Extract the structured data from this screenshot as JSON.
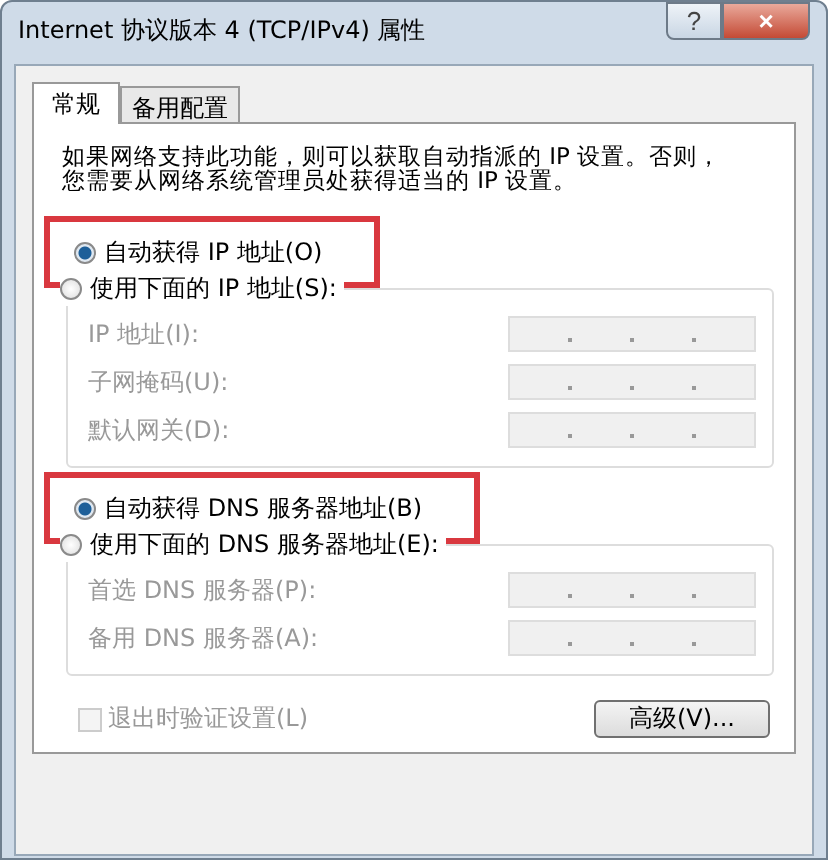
{
  "window": {
    "title": "Internet 协议版本 4 (TCP/IPv4) 属性",
    "help_button": "?",
    "close_button": "×"
  },
  "tabs": [
    {
      "label": "常规",
      "selected": true
    },
    {
      "label": "备用配置",
      "selected": false
    }
  ],
  "description": "如果网络支持此功能，则可以获取自动指派的 IP 设置。否则，您需要从网络系统管理员处获得适当的 IP 设置。",
  "sections": [
    {
      "auto_option": {
        "label": "自动获得 IP 地址(O)",
        "selected": true,
        "highlighted": true
      },
      "manual_option": {
        "label": "使用下面的 IP 地址(S):",
        "selected": false
      },
      "fields": [
        {
          "label": "IP 地址(I):",
          "disabled": true
        },
        {
          "label": "子网掩码(U):",
          "disabled": true
        },
        {
          "label": "默认网关(D):",
          "disabled": true
        }
      ]
    },
    {
      "auto_option": {
        "label": "自动获得 DNS 服务器地址(B)",
        "selected": true,
        "highlighted": true
      },
      "manual_option": {
        "label": "使用下面的 DNS 服务器地址(E):",
        "selected": false
      },
      "fields": [
        {
          "label": "首选 DNS 服务器(P):",
          "disabled": true
        },
        {
          "label": "备用 DNS 服务器(A):",
          "disabled": true
        }
      ]
    }
  ],
  "validate_checkbox": {
    "label": "退出时验证设置(L)",
    "checked": false,
    "disabled": true
  },
  "advanced_button": "高级(V)..."
}
